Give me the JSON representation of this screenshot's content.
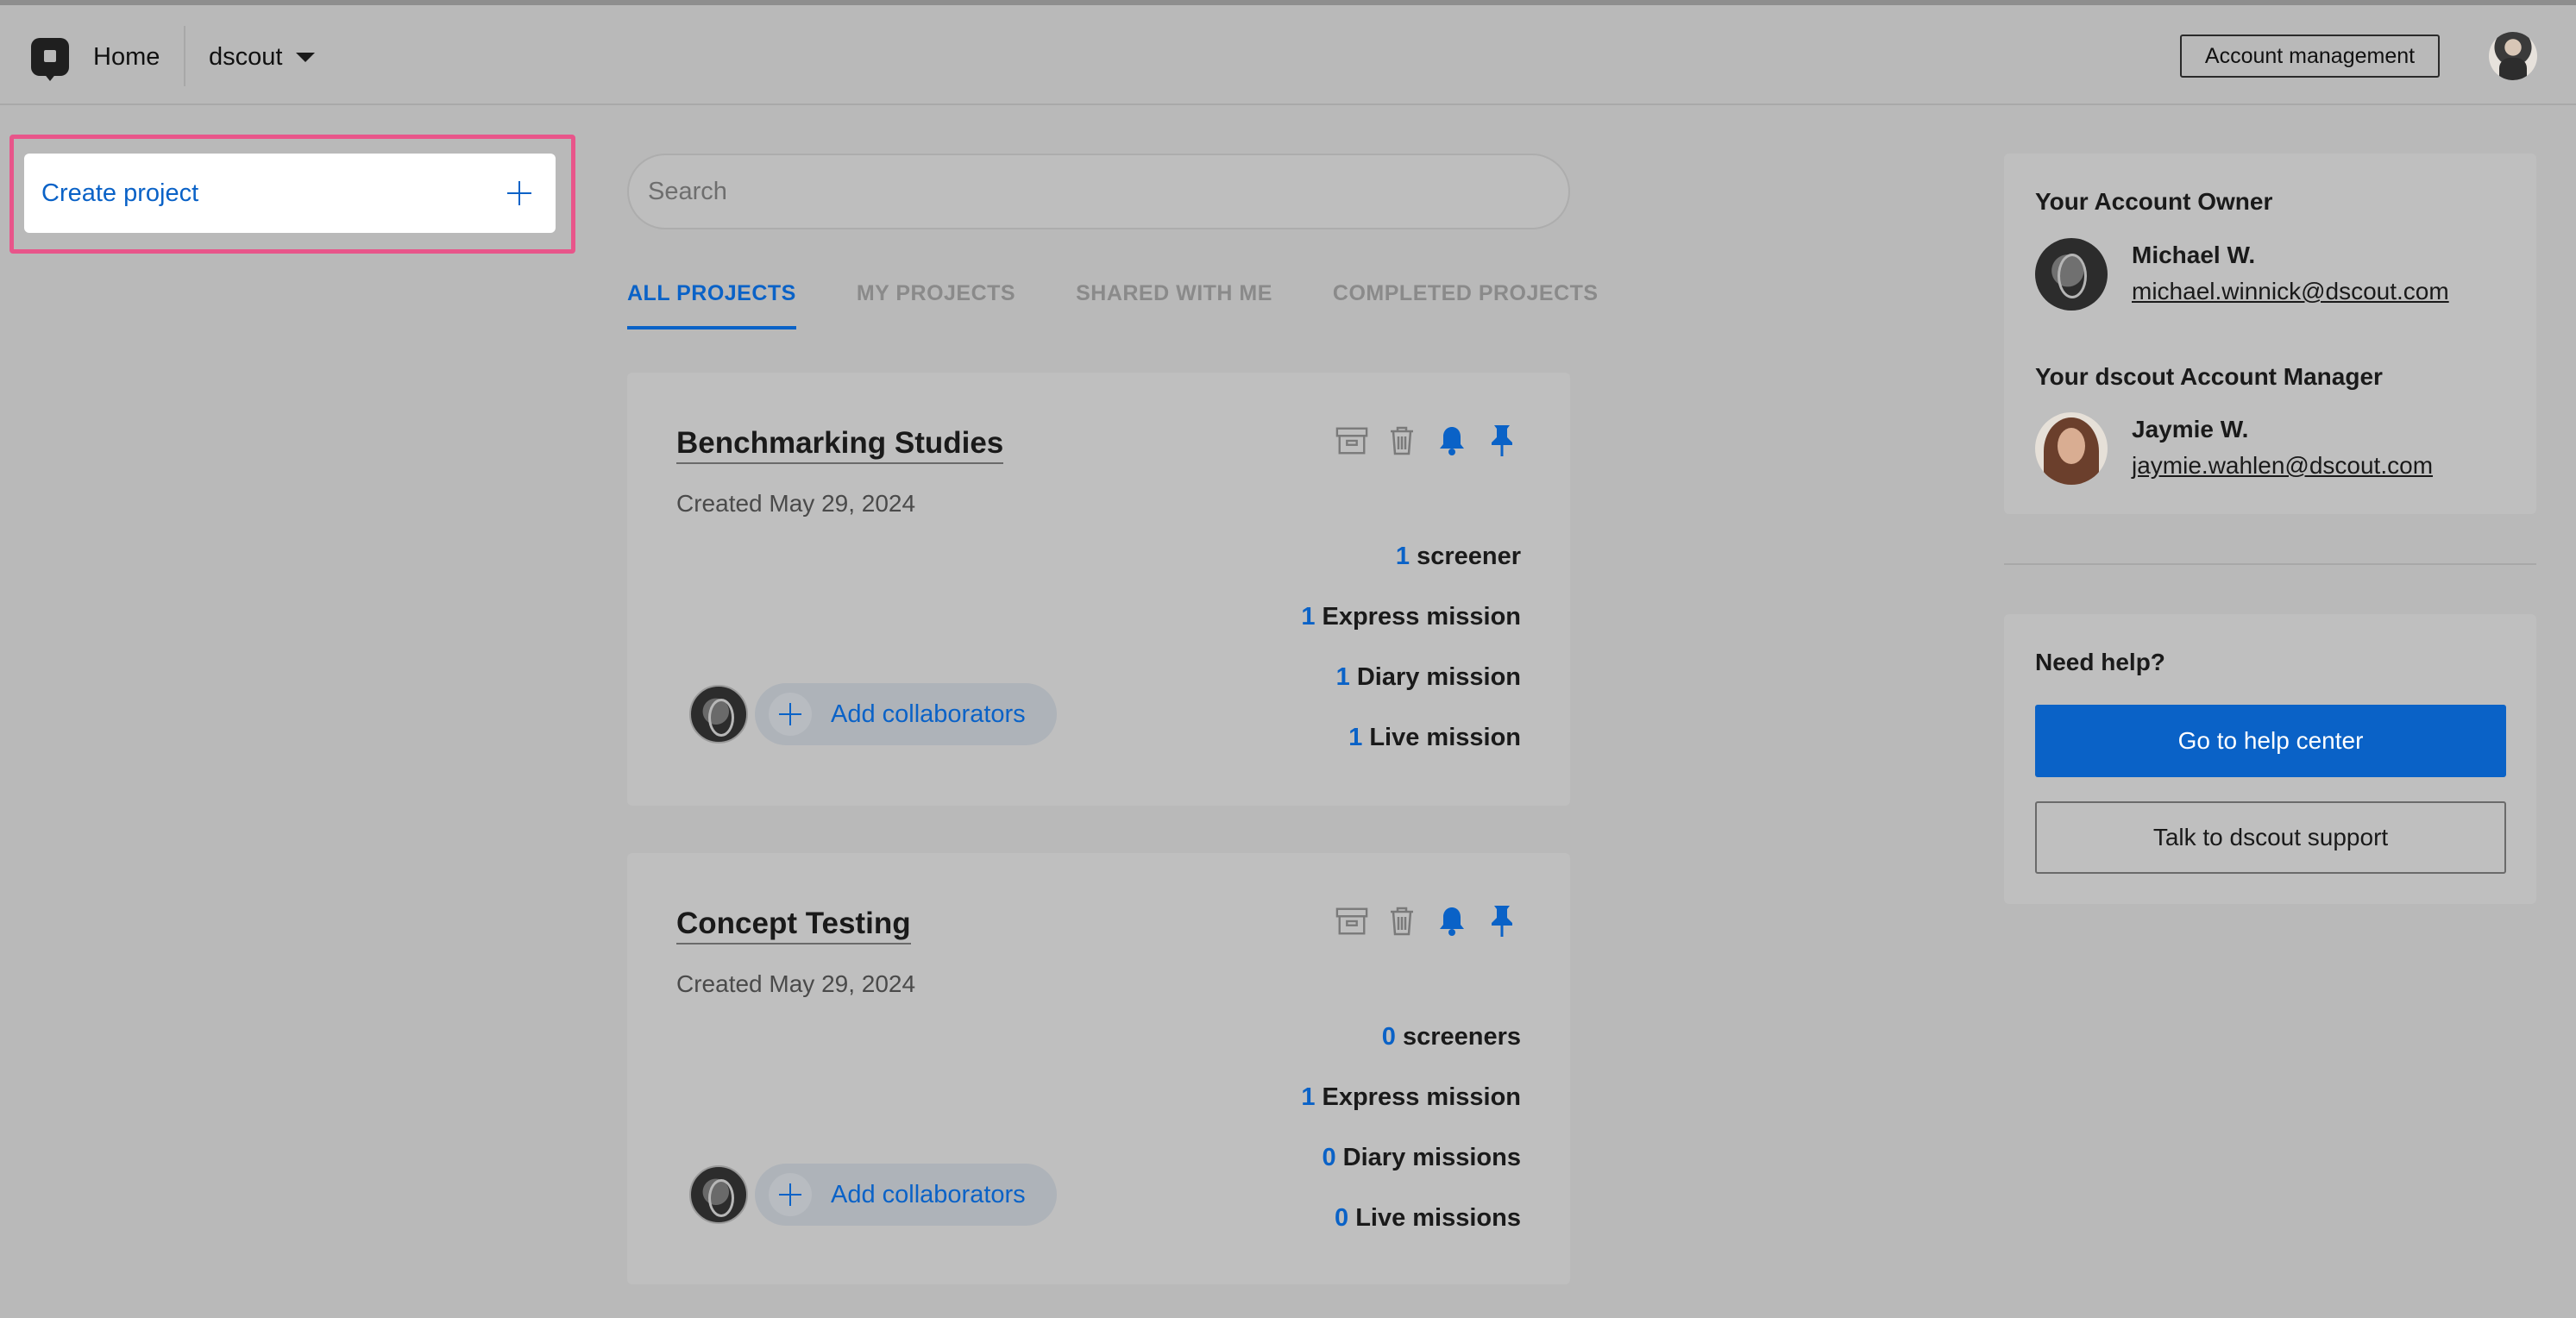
{
  "header": {
    "home_label": "Home",
    "org_name": "dscout",
    "account_management_label": "Account management"
  },
  "sidebar": {
    "create_project_label": "Create project"
  },
  "search": {
    "placeholder": "Search",
    "value": ""
  },
  "tabs": [
    {
      "label": "ALL PROJECTS",
      "active": true
    },
    {
      "label": "MY PROJECTS",
      "active": false
    },
    {
      "label": "SHARED WITH ME",
      "active": false
    },
    {
      "label": "COMPLETED PROJECTS",
      "active": false
    }
  ],
  "projects": [
    {
      "title": "Benchmarking Studies",
      "created": "Created May 29, 2024",
      "stats": [
        {
          "count": "1",
          "label": "screener"
        },
        {
          "count": "1",
          "label": "Express mission"
        },
        {
          "count": "1",
          "label": "Diary mission"
        },
        {
          "count": "1",
          "label": "Live mission"
        }
      ],
      "add_collaborators_label": "Add collaborators"
    },
    {
      "title": "Concept Testing",
      "created": "Created May 29, 2024",
      "stats": [
        {
          "count": "0",
          "label": "screeners"
        },
        {
          "count": "1",
          "label": "Express mission"
        },
        {
          "count": "0",
          "label": "Diary missions"
        },
        {
          "count": "0",
          "label": "Live missions"
        }
      ],
      "add_collaborators_label": "Add collaborators"
    }
  ],
  "account": {
    "owner_heading": "Your Account Owner",
    "owner_name": "Michael W.",
    "owner_email": "michael.winnick@dscout.com",
    "manager_heading": "Your dscout Account Manager",
    "manager_name": "Jaymie W.",
    "manager_email": "jaymie.wahlen@dscout.com"
  },
  "help": {
    "heading": "Need help?",
    "help_center_label": "Go to help center",
    "support_label": "Talk to dscout support"
  },
  "colors": {
    "accent": "#0a62c7",
    "highlight": "#e8558a",
    "overlay_background": "#b9b9b9"
  }
}
